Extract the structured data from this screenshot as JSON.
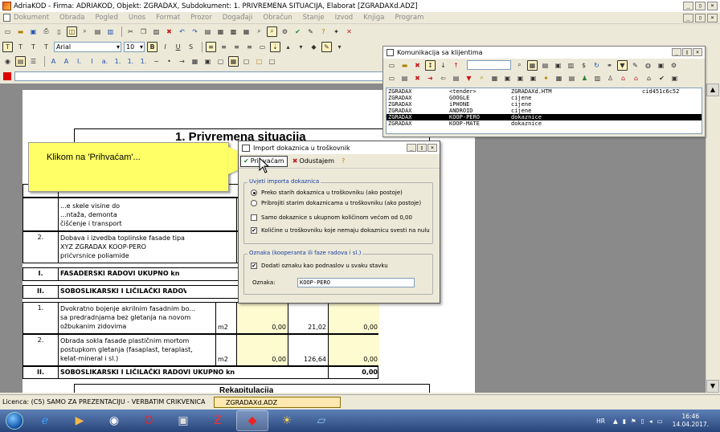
{
  "window": {
    "title": "AdriaKOD - Firma: ADRIAKOD,   Objekt: ZGRADAX,   Subdokument: 1. PRIVREMENA SITUACIJA,  Elaborat [ZGRADAXd.ADZ]",
    "controls": [
      "_",
      "▯",
      "×"
    ],
    "doc_controls": [
      "_",
      "▯",
      "×"
    ]
  },
  "menu": [
    "Dokument",
    "Obrada",
    "Pogled",
    "Unos",
    "Format",
    "Prozor",
    "Događaji",
    "Obračun",
    "Stanje",
    "Izvod",
    "Knjiga",
    "Program"
  ],
  "format_toolbar": {
    "font": "Arial",
    "size": "10"
  },
  "document": {
    "title": "1. Privremena situacija",
    "col_header": "2",
    "rows": [
      {
        "kind": "section",
        "num": "",
        "text": "...OVI"
      },
      {
        "kind": "item",
        "num": "",
        "text": "...e skele visine do\n...ntaža, demonta\nčišćenje i transport"
      },
      {
        "kind": "item",
        "num": "2.",
        "text": "Dobava i izvedba toplinske fasade tipa\nXYZ ZGRADAX  KOOP-PERO\nprićvrsnice poliamide"
      },
      {
        "kind": "total",
        "num": "I.",
        "text": "FASADERSKI RADOVI UKUPNO kn"
      },
      {
        "kind": "section",
        "num": "II.",
        "text": "SOBOSLIKARSKI I LIČILAČKI RADOVI"
      },
      {
        "kind": "item",
        "num": "1.",
        "text": "Dvokratno bojenje akrilnim fasadnim bo...\nsa predradnjama bez gletanja na novom\nožbukanim zidovima",
        "unit": "m2",
        "qty": "0,00",
        "price": "21,02",
        "amount": "0,00"
      },
      {
        "kind": "item",
        "num": "2.",
        "text": "Obrada sokla fasade plastičnim mortom\npostupkom gletanja (fasaplast, teraplast,\nkelat-mineral i sl.)",
        "unit": "m2",
        "qty": "0,00",
        "price": "126,64",
        "amount": "0,00"
      },
      {
        "kind": "total",
        "num": "II.",
        "text": "SOBOSLIKARSKI I LIČILAČKI RADOVI UKUPNO kn",
        "amount": "0,00"
      }
    ],
    "row1_amount": "0,00",
    "footer_fragment": "Rekapitulacija"
  },
  "callout": {
    "text": "Klikom na 'Prihvaćam'..."
  },
  "komunikacija": {
    "title": "Komunikacija sa klijentima",
    "rows": [
      {
        "a": "ZGRADAX",
        "b": "<tender>",
        "c": "ZGRADAXd.HTM",
        "d": "cid451c6c52",
        "selected": false
      },
      {
        "a": "ZGRADAX",
        "b": "GOOGLE",
        "c": "cijene",
        "d": "",
        "selected": false
      },
      {
        "a": "ZGRADAX",
        "b": "iPHONE",
        "c": "cijene",
        "d": "",
        "selected": false
      },
      {
        "a": "ZGRADAX",
        "b": "ANDROID",
        "c": "cijene",
        "d": "",
        "selected": false
      },
      {
        "a": "ZGRADAX",
        "b": "KOOP-PERO",
        "c": "dokaznice",
        "d": "",
        "selected": true
      },
      {
        "a": "ZGRADAX",
        "b": "KOOP-MATE",
        "c": "dokaznice",
        "d": "",
        "selected": false
      }
    ]
  },
  "dialog": {
    "title": "Import dokaznica u troškovnik",
    "accept": "Prihvaćam",
    "cancel": "Odustajem",
    "group1": "Uvjeti importa dokaznica",
    "opt_replace": "Preko starih dokaznica u troškovniku (ako postoje)",
    "opt_append": "Pribrojiti starim dokaznicama u troškovniku (ako postoje)",
    "opt_only_qty": "Samo dokaznice s ukupnom količinom većom od 0,00",
    "opt_qty_zero": "Količine u troškovniku koje nemaju dokaznicu svesti na nulu",
    "group2": "Oznaka (kooperanta ili faze radova i sl.)",
    "opt_add_tag": "Dodati oznaku kao podnaslov u svaku stavku",
    "tag_label": "Oznaka:",
    "tag_value": "KOOP-PERO"
  },
  "status": {
    "license": "Licenca:  (C5) SAMO ZA PREZENTACIJU - VERBATIM CRIKVENICA",
    "doc_tab": "ZGRADAXd.ADZ"
  },
  "taskbar": {
    "lang": "HR",
    "time": "16:46",
    "date": "14.04.2017."
  }
}
